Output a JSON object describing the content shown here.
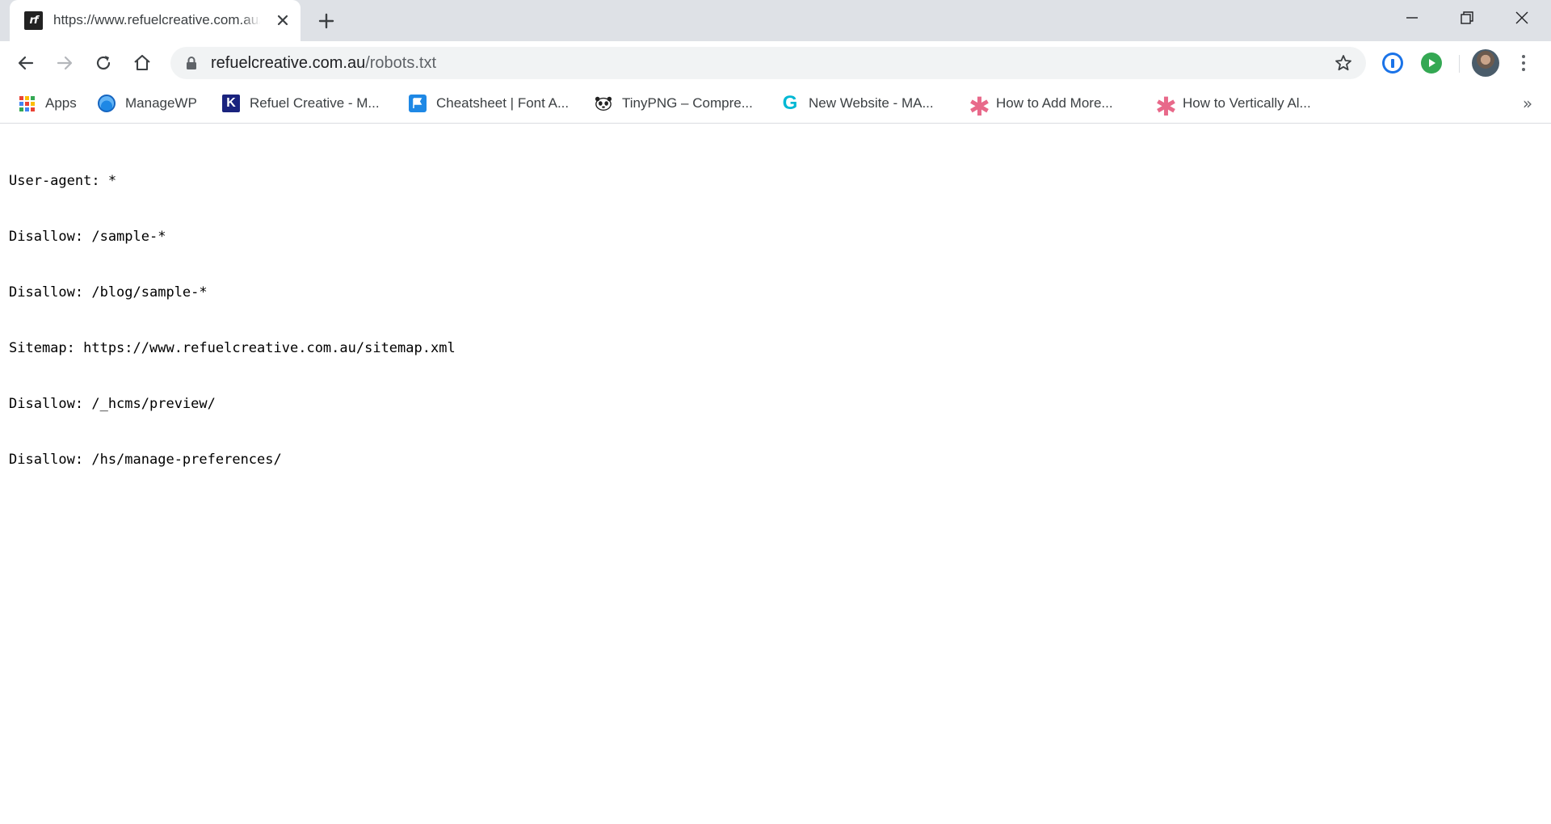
{
  "tab": {
    "favicon_text": "rf",
    "title": "https://www.refuelcreative.com.au/robots.txt"
  },
  "omnibox": {
    "host": "refuelcreative.com.au",
    "path": "/robots.txt"
  },
  "bookmarks": [
    {
      "label": "Apps",
      "icon": "apps-grid-icon"
    },
    {
      "label": "ManageWP",
      "icon": "managewp-icon"
    },
    {
      "label": "Refuel Creative - M...",
      "icon": "k-logo-icon"
    },
    {
      "label": "Cheatsheet | Font A...",
      "icon": "flag-icon"
    },
    {
      "label": "TinyPNG – Compre...",
      "icon": "panda-icon"
    },
    {
      "label": "New Website - MA...",
      "icon": "g-logo-icon"
    },
    {
      "label": "How to Add More...",
      "icon": "asterisk-icon"
    },
    {
      "label": "How to Vertically Al...",
      "icon": "asterisk-icon"
    }
  ],
  "bookmarks_overflow": "»",
  "k_logo_letter": "K",
  "g_logo_letter": "G",
  "asterisk_glyph": "✱",
  "content": {
    "lines": [
      "User-agent: *",
      "Disallow: /sample-*",
      "Disallow: /blog/sample-*",
      "Sitemap: https://www.refuelcreative.com.au/sitemap.xml",
      "Disallow: /_hcms/preview/",
      "Disallow: /hs/manage-preferences/"
    ]
  },
  "colors": {
    "tabstrip_bg": "#dee1e6",
    "omnibox_bg": "#f1f3f4",
    "apps_grid": [
      "#ea4335",
      "#fbbc04",
      "#34a853",
      "#4285f4",
      "#ea4335",
      "#fbbc04",
      "#34a853",
      "#4285f4",
      "#ea4335"
    ]
  }
}
